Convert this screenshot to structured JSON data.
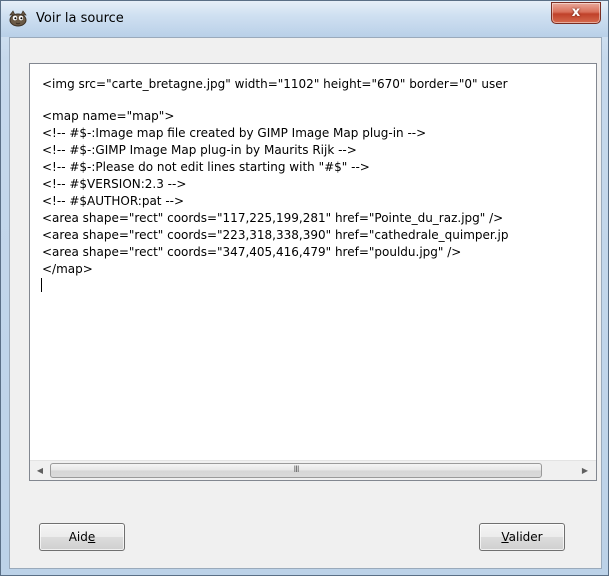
{
  "window": {
    "title": "Voir la source",
    "close_glyph": "x"
  },
  "editor": {
    "lines": [
      "<img src=\"carte_bretagne.jpg\" width=\"1102\" height=\"670\" border=\"0\" user",
      "",
      "<map name=\"map\">",
      "<!-- #$-:Image map file created by GIMP Image Map plug-in -->",
      "<!-- #$-:GIMP Image Map plug-in by Maurits Rijk -->",
      "<!-- #$-:Please do not edit lines starting with \"#$\" -->",
      "<!-- #$VERSION:2.3 -->",
      "<!-- #$AUTHOR:pat -->",
      "<area shape=\"rect\" coords=\"117,225,199,281\" href=\"Pointe_du_raz.jpg\" />",
      "<area shape=\"rect\" coords=\"223,318,338,390\" href=\"cathedrale_quimper.jp",
      "<area shape=\"rect\" coords=\"347,405,416,479\" href=\"pouldu.jpg\" />",
      "</map>"
    ],
    "scroll_grip": "III"
  },
  "buttons": {
    "help_label_prefix": "Aid",
    "help_label_mnemonic": "e",
    "ok_label_mnemonic": "V",
    "ok_label_suffix": "alider"
  },
  "icons": {
    "app_icon": "gimp-wilber-icon",
    "close": "close-icon",
    "scroll_left": "scroll-left-arrow-icon",
    "scroll_right": "scroll-right-arrow-icon"
  }
}
